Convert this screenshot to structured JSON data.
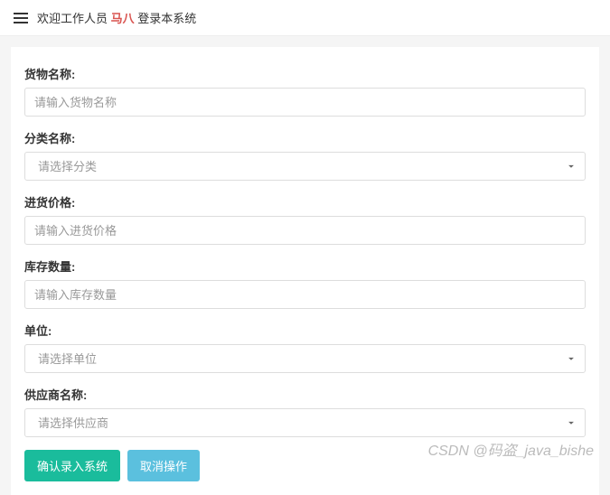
{
  "header": {
    "welcome_prefix": "欢迎工作人员",
    "username": "马八",
    "welcome_suffix": "登录本系统"
  },
  "form": {
    "goods_name": {
      "label": "货物名称:",
      "placeholder": "请输入货物名称",
      "value": ""
    },
    "category": {
      "label": "分类名称:",
      "placeholder": "请选择分类",
      "value": ""
    },
    "purchase_price": {
      "label": "进货价格:",
      "placeholder": "请输入进货价格",
      "value": ""
    },
    "stock_quantity": {
      "label": "库存数量:",
      "placeholder": "请输入库存数量",
      "value": ""
    },
    "unit": {
      "label": "单位:",
      "placeholder": "请选择单位",
      "value": ""
    },
    "supplier": {
      "label": "供应商名称:",
      "placeholder": "请选择供应商",
      "value": ""
    }
  },
  "buttons": {
    "submit": "确认录入系统",
    "cancel": "取消操作"
  },
  "watermark": "CSDN @码盗_java_bishe"
}
